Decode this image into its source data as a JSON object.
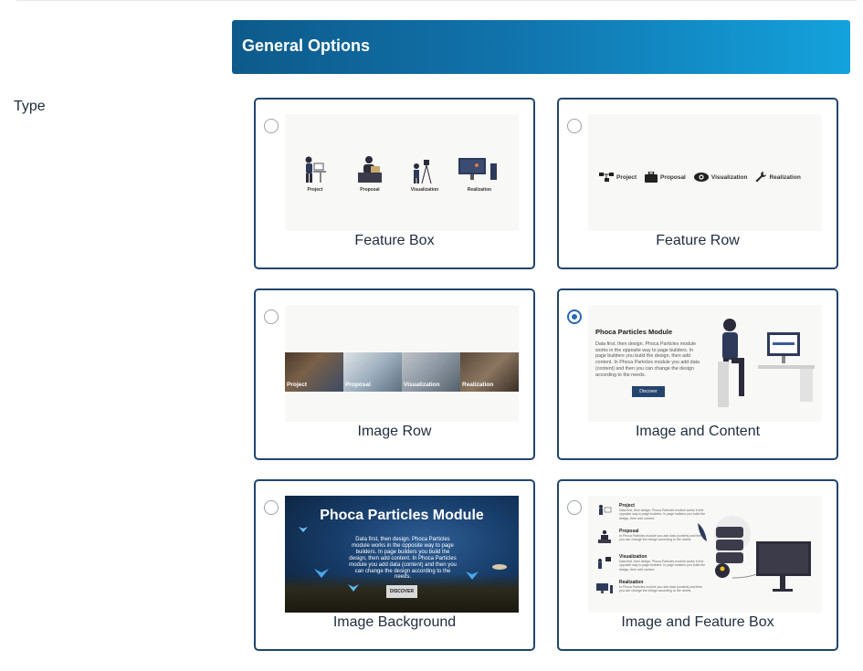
{
  "section": {
    "title": "General Options"
  },
  "field": {
    "label": "Type"
  },
  "options": [
    {
      "caption": "Feature Box",
      "selected": false,
      "thumb": {
        "items": [
          "Project",
          "Proposal",
          "Visualization",
          "Realization"
        ]
      }
    },
    {
      "caption": "Feature Row",
      "selected": false,
      "thumb": {
        "items": [
          "Project",
          "Proposal",
          "Visualization",
          "Realization"
        ]
      }
    },
    {
      "caption": "Image Row",
      "selected": false,
      "thumb": {
        "items": [
          "Project",
          "Proposal",
          "Visualization",
          "Realization"
        ]
      }
    },
    {
      "caption": "Image and Content",
      "selected": true,
      "thumb": {
        "title": "Phoca Particles Module",
        "text": "Data first, then design. Phoca Particles module works in the opposite way to page builders. In page builders you build the design, then add content. In Phoca Particles module you add data (content) and then you can change the design according to the needs.",
        "button": "Discover"
      }
    },
    {
      "caption": "Image Background",
      "selected": false,
      "thumb": {
        "title": "Phoca Particles Module",
        "text": "Data first, then design. Phoca Particles module works in the opposite way to page builders. In page builders you build the design, then add content. In Phoca Particles module you add data (content) and then you can change the design according to the needs.",
        "button": "DISCOVER"
      }
    },
    {
      "caption": "Image and Feature Box",
      "selected": false,
      "thumb": {
        "items": [
          {
            "title": "Project",
            "text": "Data first, then design. Phoca Particles module works in the opposite way to page builders. In page builders you build the design, then add content."
          },
          {
            "title": "Proposal",
            "text": "In Phoca Particles module you add data (content) and then you can change the design according to the needs."
          },
          {
            "title": "Visualization",
            "text": "Data first, then design. Phoca Particles module works in the opposite way to page builders. In page builders you build the design, then add content."
          },
          {
            "title": "Realization",
            "text": "In Phoca Particles module you add data (content) and then you can change the design according to the needs."
          }
        ]
      }
    }
  ],
  "colors": {
    "header_start": "#0d5a8a",
    "header_end": "#14a2dc",
    "card_border": "#20456d",
    "radio_selected": "#2a67b4"
  }
}
